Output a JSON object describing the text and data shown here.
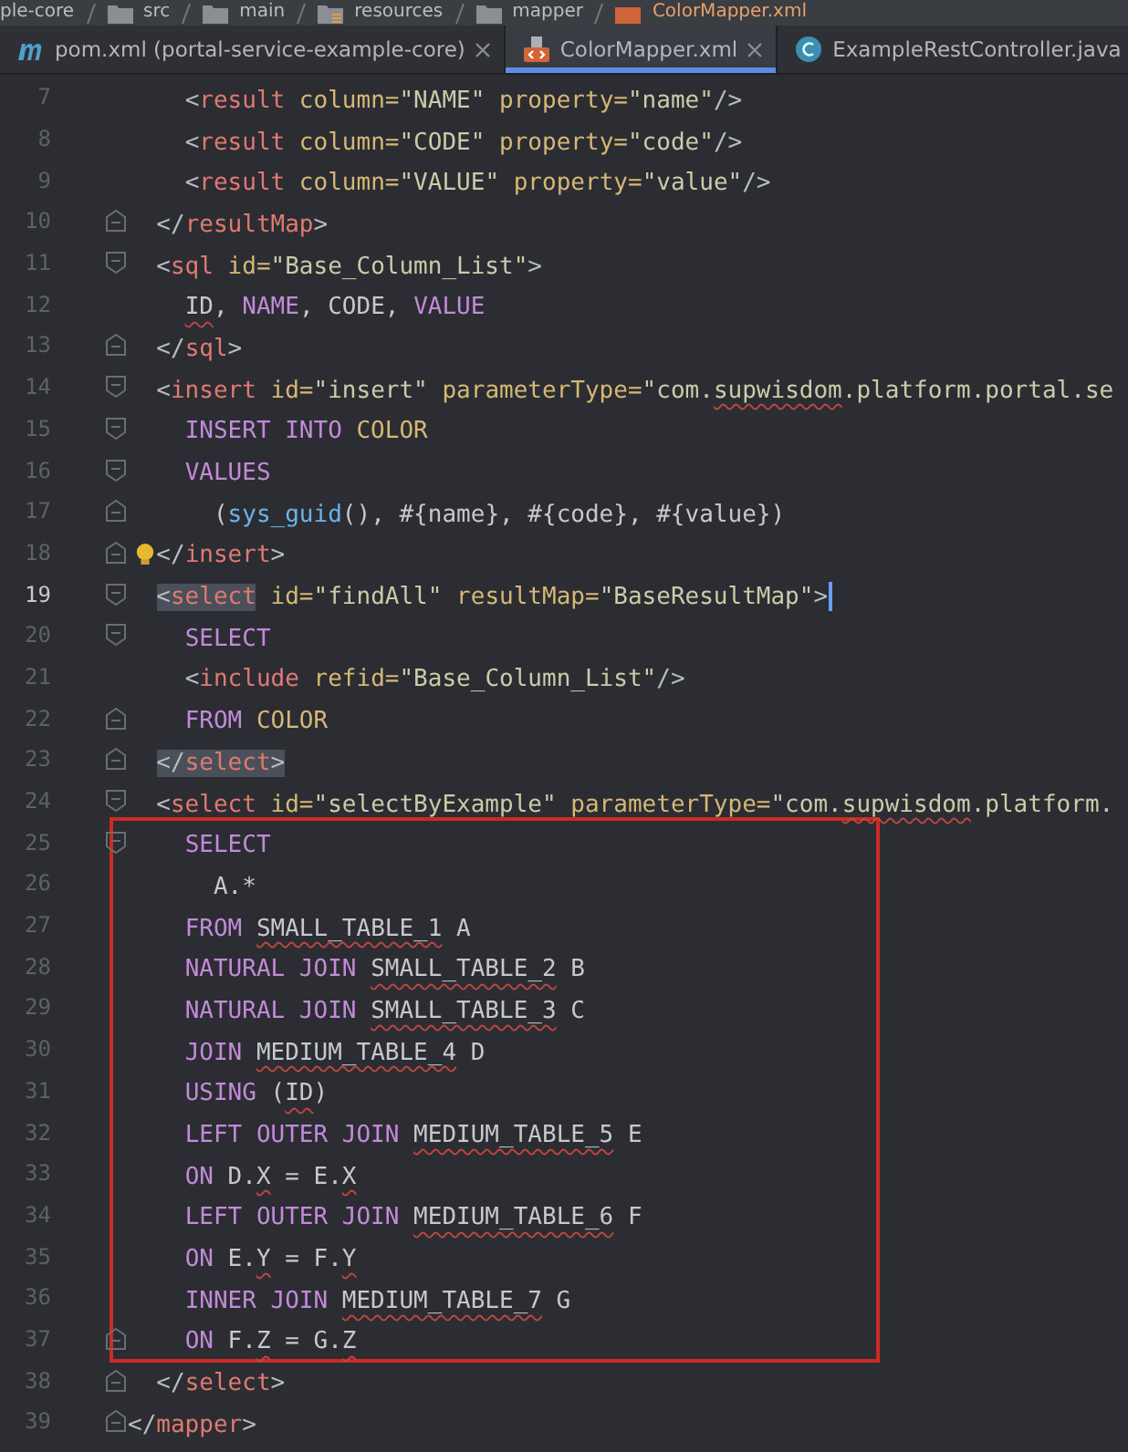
{
  "breadcrumb": [
    {
      "label": "ple-core",
      "kind": "module"
    },
    {
      "label": "src",
      "kind": "folder"
    },
    {
      "label": "main",
      "kind": "folder"
    },
    {
      "label": "resources",
      "kind": "resources"
    },
    {
      "label": "mapper",
      "kind": "folder"
    },
    {
      "label": "ColorMapper.xml",
      "kind": "xml"
    }
  ],
  "tabs": [
    {
      "label": "pom.xml (portal-service-example-core)",
      "kind": "maven",
      "selected": false
    },
    {
      "label": "ColorMapper.xml",
      "kind": "xml",
      "selected": true
    },
    {
      "label": "ExampleRestController.java",
      "kind": "class",
      "selected": false
    }
  ],
  "blocks": [
    {
      "lines": [
        {
          "number": "7",
          "tokens": [
            {
              "kind": "bracket",
              "text": "    <"
            },
            {
              "kind": "tag",
              "text": "result"
            },
            {
              "kind": "attr",
              "text": " column="
            },
            {
              "kind": "string",
              "text": "\"NAME\""
            },
            {
              "kind": "attr",
              "text": " property="
            },
            {
              "kind": "string",
              "text": "\"name\""
            },
            {
              "kind": "bracket",
              "text": "/>"
            }
          ]
        },
        {
          "number": "8",
          "tokens": [
            {
              "kind": "bracket",
              "text": "    <"
            },
            {
              "kind": "tag",
              "text": "result"
            },
            {
              "kind": "attr",
              "text": " column="
            },
            {
              "kind": "string",
              "text": "\"CODE\""
            },
            {
              "kind": "attr",
              "text": " property="
            },
            {
              "kind": "string",
              "text": "\"code\""
            },
            {
              "kind": "bracket",
              "text": "/>"
            }
          ]
        },
        {
          "number": "9",
          "tokens": [
            {
              "kind": "bracket",
              "text": "    <"
            },
            {
              "kind": "tag",
              "text": "result"
            },
            {
              "kind": "attr",
              "text": " column="
            },
            {
              "kind": "string",
              "text": "\"VALUE\""
            },
            {
              "kind": "attr",
              "text": " property="
            },
            {
              "kind": "string",
              "text": "\"value\""
            },
            {
              "kind": "bracket",
              "text": "/>"
            }
          ]
        },
        {
          "number": "10",
          "fold_end": true,
          "tokens": [
            {
              "kind": "bracket",
              "text": "  </"
            },
            {
              "kind": "tag",
              "text": "resultMap"
            },
            {
              "kind": "bracket",
              "text": ">"
            }
          ]
        },
        {
          "number": "11",
          "fold_start": true,
          "tokens": [
            {
              "kind": "bracket",
              "text": "  <"
            },
            {
              "kind": "tag",
              "text": "sql"
            },
            {
              "kind": "attr",
              "text": " id="
            },
            {
              "kind": "string",
              "text": "\"Base_Column_List\""
            },
            {
              "kind": "bracket",
              "text": ">"
            }
          ]
        },
        {
          "number": "12",
          "tokens": [
            {
              "kind": "plain",
              "text": "    ID",
              "typo": true
            },
            {
              "kind": "plain",
              "text": ", "
            },
            {
              "kind": "keyword",
              "text": "NAME"
            },
            {
              "kind": "plain",
              "text": ", CODE, "
            },
            {
              "kind": "keyword",
              "text": "VALUE"
            }
          ]
        },
        {
          "number": "13",
          "fold_end": true,
          "tokens": [
            {
              "kind": "bracket",
              "text": "  </"
            },
            {
              "kind": "tag",
              "text": "sql"
            },
            {
              "kind": "bracket",
              "text": ">"
            }
          ]
        },
        {
          "number": "14",
          "fold_start": true,
          "tokens": [
            {
              "kind": "bracket",
              "text": "  <"
            },
            {
              "kind": "tag",
              "text": "insert"
            },
            {
              "kind": "attr",
              "text": " id="
            },
            {
              "kind": "string",
              "text": "\"insert\""
            },
            {
              "kind": "attr",
              "text": " parameterType="
            },
            {
              "kind": "string",
              "text": "\"com."
            },
            {
              "kind": "string",
              "text": "supwisdom",
              "typo": true
            },
            {
              "kind": "string",
              "text": ".platform.portal.se"
            }
          ]
        },
        {
          "number": "15",
          "fold_start": true,
          "tokens": [
            {
              "kind": "keyword",
              "text": "    INSERT INTO "
            },
            {
              "kind": "name",
              "text": "COLOR"
            }
          ]
        },
        {
          "number": "16",
          "fold_start": true,
          "tokens": [
            {
              "kind": "keyword",
              "text": "    VALUES"
            }
          ]
        },
        {
          "number": "17",
          "fold_end": true,
          "tokens": [
            {
              "kind": "plain",
              "text": "      ("
            },
            {
              "kind": "function",
              "text": "sys_guid"
            },
            {
              "kind": "plain",
              "text": "(), #{name}, #{code}, #{value})"
            }
          ]
        },
        {
          "number": "18",
          "fold_end": true,
          "bulb": true,
          "tokens": [
            {
              "kind": "bracket",
              "text": "  </"
            },
            {
              "kind": "tag",
              "text": "insert"
            },
            {
              "kind": "bracket",
              "text": ">"
            }
          ]
        },
        {
          "number": "19",
          "fold_start": true,
          "current": true,
          "caret": true,
          "tokens": [
            {
              "kind": "bracket",
              "text": "  <",
              "match": true
            },
            {
              "kind": "tag",
              "text": "select",
              "match": true
            },
            {
              "kind": "attr",
              "text": " id="
            },
            {
              "kind": "string",
              "text": "\"findAll\""
            },
            {
              "kind": "attr",
              "text": " resultMap="
            },
            {
              "kind": "string",
              "text": "\"BaseResultMap\""
            },
            {
              "kind": "bracket",
              "text": ">"
            }
          ]
        },
        {
          "number": "20",
          "fold_start": true,
          "tokens": [
            {
              "kind": "keyword",
              "text": "    SELECT"
            }
          ]
        },
        {
          "number": "21",
          "tokens": [
            {
              "kind": "bracket",
              "text": "    <"
            },
            {
              "kind": "tag",
              "text": "include"
            },
            {
              "kind": "attr",
              "text": " refid="
            },
            {
              "kind": "string",
              "text": "\"Base_Column_List\""
            },
            {
              "kind": "bracket",
              "text": "/>"
            }
          ]
        },
        {
          "number": "22",
          "fold_end": true,
          "tokens": [
            {
              "kind": "keyword",
              "text": "    FROM "
            },
            {
              "kind": "name",
              "text": "COLOR"
            }
          ]
        },
        {
          "number": "23",
          "fold_end": true,
          "tokens": [
            {
              "kind": "bracket",
              "text": "  </",
              "match": true
            },
            {
              "kind": "tag",
              "text": "select",
              "match": true
            },
            {
              "kind": "bracket",
              "text": ">",
              "match": true
            }
          ]
        },
        {
          "number": "24",
          "fold_start": true,
          "tokens": [
            {
              "kind": "bracket",
              "text": "  <"
            },
            {
              "kind": "tag",
              "text": "select"
            },
            {
              "kind": "attr",
              "text": " id="
            },
            {
              "kind": "string",
              "text": "\"selectByExample\""
            },
            {
              "kind": "attr",
              "text": " parameterType="
            },
            {
              "kind": "string",
              "text": "\"com."
            },
            {
              "kind": "string",
              "text": "supwisdom",
              "typo": true
            },
            {
              "kind": "string",
              "text": ".platform."
            }
          ]
        }
      ]
    },
    {
      "framed": true,
      "lines": [
        {
          "number": "25",
          "fold_start": true,
          "tokens": [
            {
              "kind": "keyword",
              "text": "    SELECT"
            }
          ]
        },
        {
          "number": "26",
          "tokens": [
            {
              "kind": "plain",
              "text": "      A.*"
            }
          ]
        },
        {
          "number": "27",
          "tokens": [
            {
              "kind": "keyword",
              "text": "    FROM "
            },
            {
              "kind": "plain",
              "text": "SMALL_TABLE_1",
              "typo": true
            },
            {
              "kind": "plain",
              "text": " A"
            }
          ]
        },
        {
          "number": "28",
          "tokens": [
            {
              "kind": "keyword",
              "text": "    NATURAL JOIN "
            },
            {
              "kind": "plain",
              "text": "SMALL_TABLE_2",
              "typo": true
            },
            {
              "kind": "plain",
              "text": " B"
            }
          ]
        },
        {
          "number": "29",
          "tokens": [
            {
              "kind": "keyword",
              "text": "    NATURAL JOIN "
            },
            {
              "kind": "plain",
              "text": "SMALL_TABLE_3",
              "typo": true
            },
            {
              "kind": "plain",
              "text": " C"
            }
          ]
        },
        {
          "number": "30",
          "tokens": [
            {
              "kind": "keyword",
              "text": "    JOIN "
            },
            {
              "kind": "plain",
              "text": "MEDIUM_TABLE_4",
              "typo": true
            },
            {
              "kind": "plain",
              "text": " D"
            }
          ]
        },
        {
          "number": "31",
          "tokens": [
            {
              "kind": "keyword",
              "text": "    USING "
            },
            {
              "kind": "plain",
              "text": "("
            },
            {
              "kind": "plain",
              "text": "ID",
              "typo": true
            },
            {
              "kind": "plain",
              "text": ")"
            }
          ]
        },
        {
          "number": "32",
          "tokens": [
            {
              "kind": "keyword",
              "text": "    LEFT OUTER JOIN "
            },
            {
              "kind": "plain",
              "text": "MEDIUM_TABLE_5",
              "typo": true
            },
            {
              "kind": "plain",
              "text": " E"
            }
          ]
        },
        {
          "number": "33",
          "tokens": [
            {
              "kind": "keyword",
              "text": "    ON "
            },
            {
              "kind": "plain",
              "text": "D."
            },
            {
              "kind": "plain",
              "text": "X",
              "typo": true
            },
            {
              "kind": "plain",
              "text": " = E."
            },
            {
              "kind": "plain",
              "text": "X",
              "typo": true
            }
          ]
        },
        {
          "number": "34",
          "tokens": [
            {
              "kind": "keyword",
              "text": "    LEFT OUTER JOIN "
            },
            {
              "kind": "plain",
              "text": "MEDIUM_TABLE_6",
              "typo": true
            },
            {
              "kind": "plain",
              "text": " F"
            }
          ]
        },
        {
          "number": "35",
          "tokens": [
            {
              "kind": "keyword",
              "text": "    ON "
            },
            {
              "kind": "plain",
              "text": "E."
            },
            {
              "kind": "plain",
              "text": "Y",
              "typo": true
            },
            {
              "kind": "plain",
              "text": " = F."
            },
            {
              "kind": "plain",
              "text": "Y",
              "typo": true
            }
          ]
        },
        {
          "number": "36",
          "tokens": [
            {
              "kind": "keyword",
              "text": "    INNER JOIN "
            },
            {
              "kind": "plain",
              "text": "MEDIUM_TABLE_7",
              "typo": true
            },
            {
              "kind": "plain",
              "text": " G"
            }
          ]
        },
        {
          "number": "37",
          "fold_end": true,
          "tokens": [
            {
              "kind": "keyword",
              "text": "    ON "
            },
            {
              "kind": "plain",
              "text": "F."
            },
            {
              "kind": "plain",
              "text": "Z",
              "typo": true
            },
            {
              "kind": "plain",
              "text": " = G."
            },
            {
              "kind": "plain",
              "text": "Z",
              "typo": true
            }
          ]
        }
      ]
    },
    {
      "lines": [
        {
          "number": "38",
          "fold_end": true,
          "tokens": [
            {
              "kind": "bracket",
              "text": "  </"
            },
            {
              "kind": "tag",
              "text": "select"
            },
            {
              "kind": "bracket",
              "text": ">"
            }
          ]
        },
        {
          "number": "39",
          "fold_end": true,
          "tokens": [
            {
              "kind": "bracket",
              "text": "</"
            },
            {
              "kind": "tag",
              "text": "mapper"
            },
            {
              "kind": "bracket",
              "text": ">"
            }
          ]
        }
      ]
    }
  ]
}
